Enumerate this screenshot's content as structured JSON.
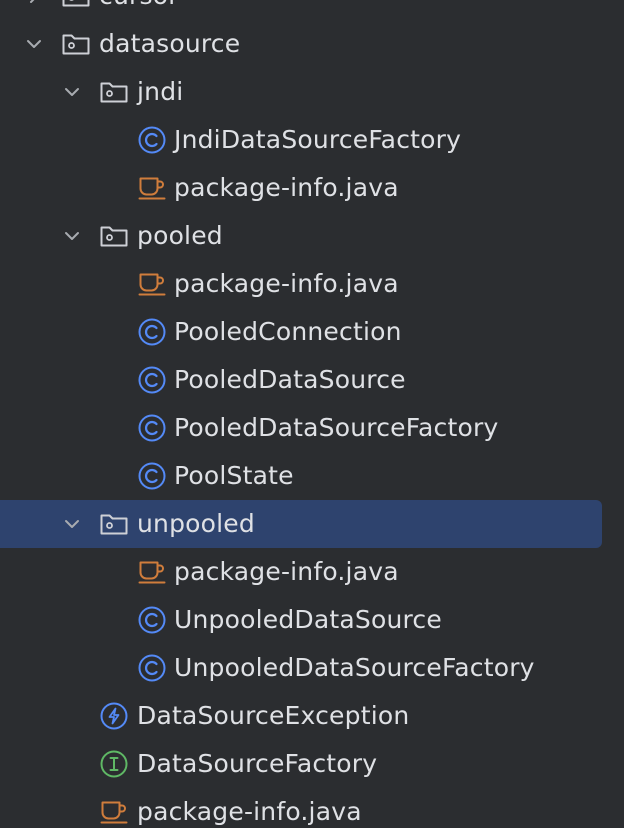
{
  "tree": {
    "rows": [
      {
        "label": "cursor",
        "kind": "folder",
        "expanded": false,
        "depth": 0
      },
      {
        "label": "datasource",
        "kind": "folder",
        "expanded": true,
        "depth": 0
      },
      {
        "label": "jndi",
        "kind": "folder",
        "expanded": true,
        "depth": 1
      },
      {
        "label": "JndiDataSourceFactory",
        "kind": "class",
        "depth": 2
      },
      {
        "label": "package-info.java",
        "kind": "java-file",
        "depth": 2
      },
      {
        "label": "pooled",
        "kind": "folder",
        "expanded": true,
        "depth": 1
      },
      {
        "label": "package-info.java",
        "kind": "java-file",
        "depth": 2
      },
      {
        "label": "PooledConnection",
        "kind": "class",
        "depth": 2
      },
      {
        "label": "PooledDataSource",
        "kind": "class",
        "depth": 2
      },
      {
        "label": "PooledDataSourceFactory",
        "kind": "class",
        "depth": 2
      },
      {
        "label": "PoolState",
        "kind": "class",
        "depth": 2
      },
      {
        "label": "unpooled",
        "kind": "folder",
        "expanded": true,
        "depth": 1,
        "selected": true
      },
      {
        "label": "package-info.java",
        "kind": "java-file",
        "depth": 2
      },
      {
        "label": "UnpooledDataSource",
        "kind": "class",
        "depth": 2
      },
      {
        "label": "UnpooledDataSourceFactory",
        "kind": "class",
        "depth": 2
      },
      {
        "label": "DataSourceException",
        "kind": "exception",
        "depth": 1
      },
      {
        "label": "DataSourceFactory",
        "kind": "interface",
        "depth": 1
      },
      {
        "label": "package-info.java",
        "kind": "java-file",
        "depth": 1
      }
    ]
  },
  "colors": {
    "background": "#2b2d30",
    "selection": "#2e436e",
    "text": "#dfe1e5",
    "class_icon": "#548af7",
    "interface_icon": "#5fb865",
    "java_file_icon": "#d07d3c",
    "folder_icon": "#ced0d6",
    "chevron": "#a8abb0"
  }
}
